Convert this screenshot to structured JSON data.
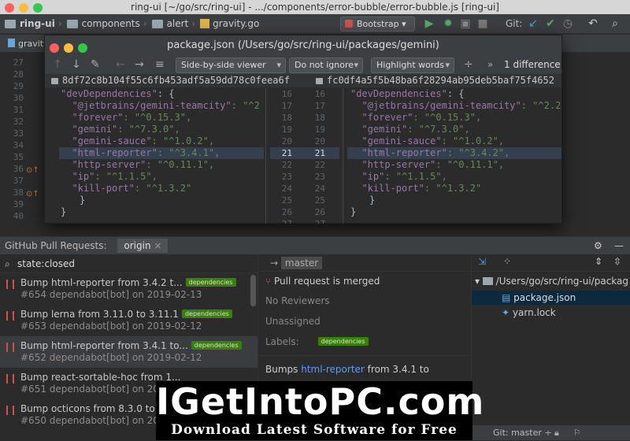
{
  "window": {
    "title": "ring-ui [~/go/src/ring-ui] - .../components/error-bubble/error-bubble.js [ring-ui]"
  },
  "breadcrumbs": [
    "ring-ui",
    "components",
    "alert",
    "gravity.go"
  ],
  "toolbar": {
    "run_config": "Bootstrap",
    "git_label": "Git:"
  },
  "tabs": [
    "gravity"
  ],
  "editor": {
    "line_numbers": [
      "27",
      "28",
      "29",
      "30",
      "31",
      "32",
      "33",
      "34",
      "35",
      "36",
      "37",
      "38",
      "39",
      "40"
    ]
  },
  "diff": {
    "title": "package.json (/Users/go/src/ring-ui/packages/gemini)",
    "viewer": "Side-by-side viewer",
    "ignore": "Do not ignore",
    "highlight": "Highlight words",
    "differences": "1 difference",
    "left_hash": "8df72c8b104f55c6fb453adf5a59dd78c0feea6f",
    "right_hash": "fc0df4a5f5b48ba6f28294ab95deb5baf75f4652",
    "left_nums": [
      "16",
      "17",
      "18",
      "19",
      "20",
      "21",
      "22",
      "23",
      "24",
      "25",
      "26",
      "27"
    ],
    "right_nums": [
      "16",
      "17",
      "18",
      "19",
      "20",
      "21",
      "22",
      "23",
      "24",
      "25",
      "26",
      "27"
    ],
    "left_lines": [
      {
        "k": "\"devDependencies\"",
        "v": ": {"
      },
      {
        "k": "  \"@jetbrains/gemini-teamcity\"",
        "v": ": \"^2"
      },
      {
        "k": "  \"forever\"",
        "v": ": \"^0.15.3\","
      },
      {
        "k": "  \"gemini\"",
        "v": ": \"^7.3.0\","
      },
      {
        "k": "  \"gemini-sauce\"",
        "v": ": \"^1.0.2\","
      },
      {
        "k": "  \"html-reporter\"",
        "v": ": \"^3.4.1\","
      },
      {
        "k": "  \"http-server\"",
        "v": ": \"^0.11.1\","
      },
      {
        "k": "  \"ip\"",
        "v": ": \"^1.1.5\","
      },
      {
        "k": "  \"kill-port\"",
        "v": ": \"^1.3.2\""
      },
      {
        "k": "",
        "v": "}"
      },
      {
        "k": "",
        "v": "}"
      }
    ],
    "right_lines": [
      {
        "k": "\"devDependencies\"",
        "v": ": {"
      },
      {
        "k": "  \"@jetbrains/gemini-teamcity\"",
        "v": ": \"^2.2."
      },
      {
        "k": "  \"forever\"",
        "v": ": \"^0.15.3\","
      },
      {
        "k": "  \"gemini\"",
        "v": ": \"^7.3.0\","
      },
      {
        "k": "  \"gemini-sauce\"",
        "v": ": \"^1.0.2\","
      },
      {
        "k": "  \"html-reporter\"",
        "v": ": \"^3.4.2\","
      },
      {
        "k": "  \"http-server\"",
        "v": ": \"^0.11.1\","
      },
      {
        "k": "  \"ip\"",
        "v": ": \"^1.1.5\","
      },
      {
        "k": "  \"kill-port\"",
        "v": ": \"^1.3.2\""
      },
      {
        "k": "",
        "v": "}"
      },
      {
        "k": "",
        "v": "}"
      }
    ]
  },
  "pr_panel": {
    "title": "GitHub Pull Requests:",
    "tab": "origin",
    "search": "state:closed",
    "items": [
      {
        "title": "Bump html-reporter from 3.4.2 t...",
        "badge": "dependencies",
        "sub": "#654 dependabot[bot] on 2019-02-13"
      },
      {
        "title": "Bump lerna from 3.11.0 to 3.11.1",
        "badge": "dependencies",
        "sub": "#653 dependabot[bot] on 2019-02-12"
      },
      {
        "title": "Bump html-reporter from 3.4.1 to...",
        "badge": "dependencies",
        "sub": "#652 dependabot[bot] on 2019-02-12"
      },
      {
        "title": "Bump react-sortable-hoc from 1...",
        "badge": "",
        "sub": "#651 dependabot[bot] on 2019-02-12"
      },
      {
        "title": "Bump octicons from 8.3.0 to",
        "badge": "",
        "sub": "#650 dependabot[bot] on 2019-02-11"
      }
    ]
  },
  "detail": {
    "branch": "master",
    "status": "Pull request is merged",
    "reviewers": "No Reviewers",
    "assignee": "Unassigned",
    "labels_label": "Labels:",
    "label": "dependencies",
    "body_prefix": "Bumps ",
    "body_link": "html-reporter",
    "body_suffix": " from 3.4.1 to"
  },
  "tree": {
    "root": "/Users/go/src/ring-ui/packag",
    "files": [
      "package.json",
      "yarn.lock"
    ]
  },
  "statusbar": {
    "git": "Git: master ÷"
  },
  "watermark": {
    "line1": "IGetIntoPC.com",
    "line2": "Download Latest Software for Free"
  }
}
